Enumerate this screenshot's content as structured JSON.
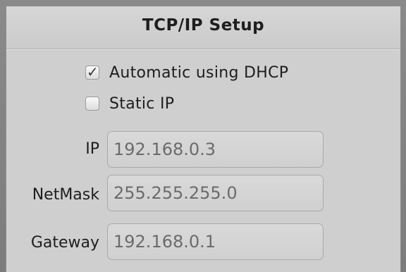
{
  "title": "TCP/IP Setup",
  "options": {
    "dhcp": {
      "label": "Automatic using DHCP",
      "checked": true
    },
    "static": {
      "label": "Static IP",
      "checked": false
    }
  },
  "fields": {
    "ip": {
      "label": "IP",
      "value": "192.168.0.3"
    },
    "netmask": {
      "label": "NetMask",
      "value": "255.255.255.0"
    },
    "gateway": {
      "label": "Gateway",
      "value": "192.168.0.1"
    }
  },
  "icons": {
    "checked": "checkmark-icon"
  }
}
